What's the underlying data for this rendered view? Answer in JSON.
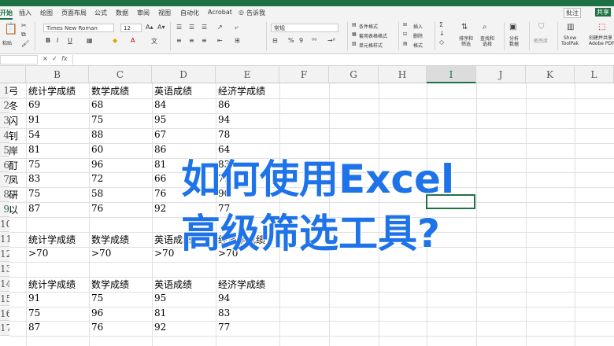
{
  "ribbon_tabs": [
    "开始",
    "插入",
    "绘图",
    "页面布局",
    "公式",
    "数据",
    "审阅",
    "视图",
    "自动化",
    "Acrobat",
    "告诉我"
  ],
  "right_buttons": {
    "comment": "批注",
    "share": "共享"
  },
  "ribbon": {
    "paste": "粘贴",
    "font_name": "Times New Roman",
    "font_size": "12",
    "number_format": "常规",
    "styles": [
      "条件格式",
      "套用表格格式",
      "单元格样式"
    ],
    "cells": [
      "插入",
      "删除",
      "格式"
    ],
    "sort_filter": "排序和\n筛选",
    "find_select": "查找和\n选择",
    "analyze": "分析\n数据",
    "sensitivity": "敏感度",
    "show_toolpak": "Show\nToolPak",
    "adobe": "创建并共享\nAdobe PDF"
  },
  "formula_bar": {
    "name_box": "",
    "fx": "fx",
    "value": ""
  },
  "grid": {
    "columns": [
      "",
      "B",
      "C",
      "D",
      "E",
      "F",
      "G",
      "H",
      "I",
      "J",
      "K",
      "L"
    ],
    "selected_column": "I",
    "rows": [
      "",
      "1",
      "2",
      "3",
      "4",
      "5",
      "6",
      "7",
      "8",
      "9",
      "10",
      "11",
      "12",
      "13",
      "14",
      "15",
      "16",
      "17"
    ],
    "selected_row": "9",
    "colA_fragments": [
      "弓",
      "冬",
      "闪",
      "钊",
      "岸",
      "酊",
      "凤",
      "硏",
      "以"
    ],
    "cells": [
      [
        "统计学成绩",
        "数学成绩",
        "英语成绩",
        "经济学成绩"
      ],
      [
        "69",
        "68",
        "84",
        "86"
      ],
      [
        "91",
        "75",
        "95",
        "94"
      ],
      [
        "54",
        "88",
        "67",
        "78"
      ],
      [
        "81",
        "60",
        "86",
        "64"
      ],
      [
        "75",
        "96",
        "81",
        "83"
      ],
      [
        "83",
        "72",
        "66",
        "71"
      ],
      [
        "75",
        "58",
        "76",
        "90"
      ],
      [
        "87",
        "76",
        "92",
        "77"
      ],
      [
        "",
        "",
        "",
        ""
      ],
      [
        "统计学成绩",
        "数学成绩",
        "英语成绩",
        "经济学成绩"
      ],
      [
        ">70",
        ">70",
        ">70",
        ">70"
      ],
      [
        "",
        "",
        "",
        ""
      ],
      [
        "统计学成绩",
        "数学成绩",
        "英语成绩",
        "经济学成绩"
      ],
      [
        "91",
        "75",
        "95",
        "94"
      ],
      [
        "75",
        "96",
        "81",
        "83"
      ],
      [
        "87",
        "76",
        "92",
        "77"
      ]
    ]
  },
  "overlay": {
    "line1": "如何使用Excel",
    "line2": "高级筛选工具?"
  }
}
